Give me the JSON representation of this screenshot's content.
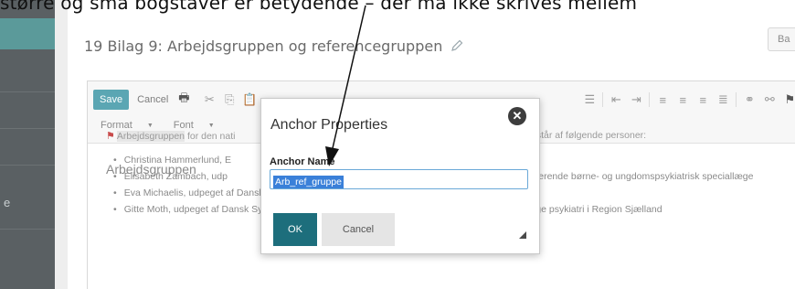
{
  "caption": "større og små bogstaver er betydende – der må ikke skrives mellem",
  "sidebar": {
    "edge_text": "e"
  },
  "page": {
    "title": "19  Bilag 9: Arbejdsgruppen og referencegruppen",
    "partial_button": "Ba"
  },
  "toolbar": {
    "save_label": "Save",
    "cancel_label": "Cancel",
    "format_label": "Format",
    "font_label": "Font"
  },
  "content": {
    "heading": "Arbejdsgruppen",
    "anchor_word": "Arbejdsgruppen",
    "para_lead": "for den nati",
    "para_tail": "estår af følgende personer:",
    "bullets": [
      "Christina Hammerlund, E",
      "Elisabeth Zambach, udp",
      "Eva Michaelis, udpeget af Dansk Selskab for Fysioterapi, Fysioterapeut",
      "Gitte Moth, udpeget af Dansk Sygepleje Selskab, Afdelingssygeplejerske, Afdeling for børn og unge psykiatri i Region Sjælland"
    ],
    "bullet2_right": "serende børne- og ungdomspsykiatrisk speciallæge"
  },
  "dialog": {
    "title": "Anchor Properties",
    "field_label": "Anchor Name",
    "anchor_value": "Arb_ref_gruppe",
    "ok_label": "OK",
    "cancel_label": "Cancel"
  },
  "colors": {
    "accent": "#5ba6b3",
    "ok_button": "#1d6e7c",
    "selection": "#3a80d9",
    "sidebar": "#5a6063"
  }
}
